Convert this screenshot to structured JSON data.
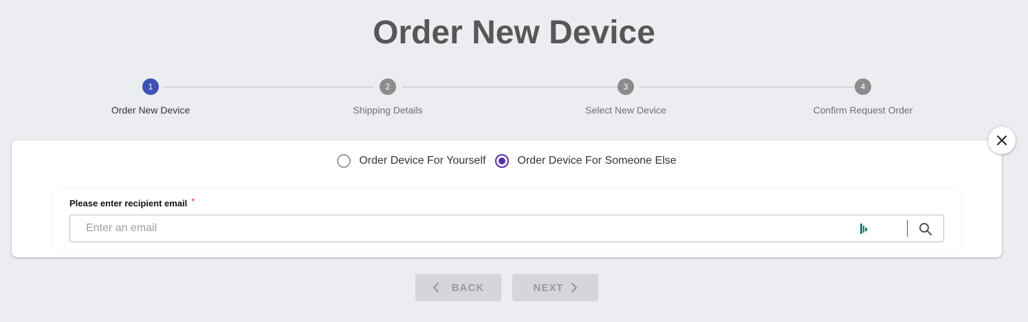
{
  "page": {
    "title": "Order New Device"
  },
  "stepper": {
    "steps": [
      {
        "number": "1",
        "label": "Order New Device",
        "active": true
      },
      {
        "number": "2",
        "label": "Shipping Details",
        "active": false
      },
      {
        "number": "3",
        "label": "Select New Device",
        "active": false
      },
      {
        "number": "4",
        "label": "Confirm Request Order",
        "active": false
      }
    ]
  },
  "order_for": {
    "options": [
      {
        "label": "Order Device For Yourself",
        "checked": false
      },
      {
        "label": "Order Device For Someone Else",
        "checked": true
      }
    ]
  },
  "recipient": {
    "label": "Please enter recipient email",
    "required_mark": "*",
    "placeholder": "Enter an email",
    "value": ""
  },
  "nav": {
    "back_label": "BACK",
    "next_label": "NEXT"
  },
  "icons": {
    "close": "close-icon",
    "search": "search-icon",
    "extension": "password-manager-icon",
    "back": "chevron-left-icon",
    "next": "chevron-right-icon"
  },
  "colors": {
    "active_step": "#3f51b5",
    "inactive_step": "#8c8c8c",
    "radio_checked": "#5b2fa6",
    "required": "#d32f2f",
    "disabled_button": "#d5d6da"
  }
}
